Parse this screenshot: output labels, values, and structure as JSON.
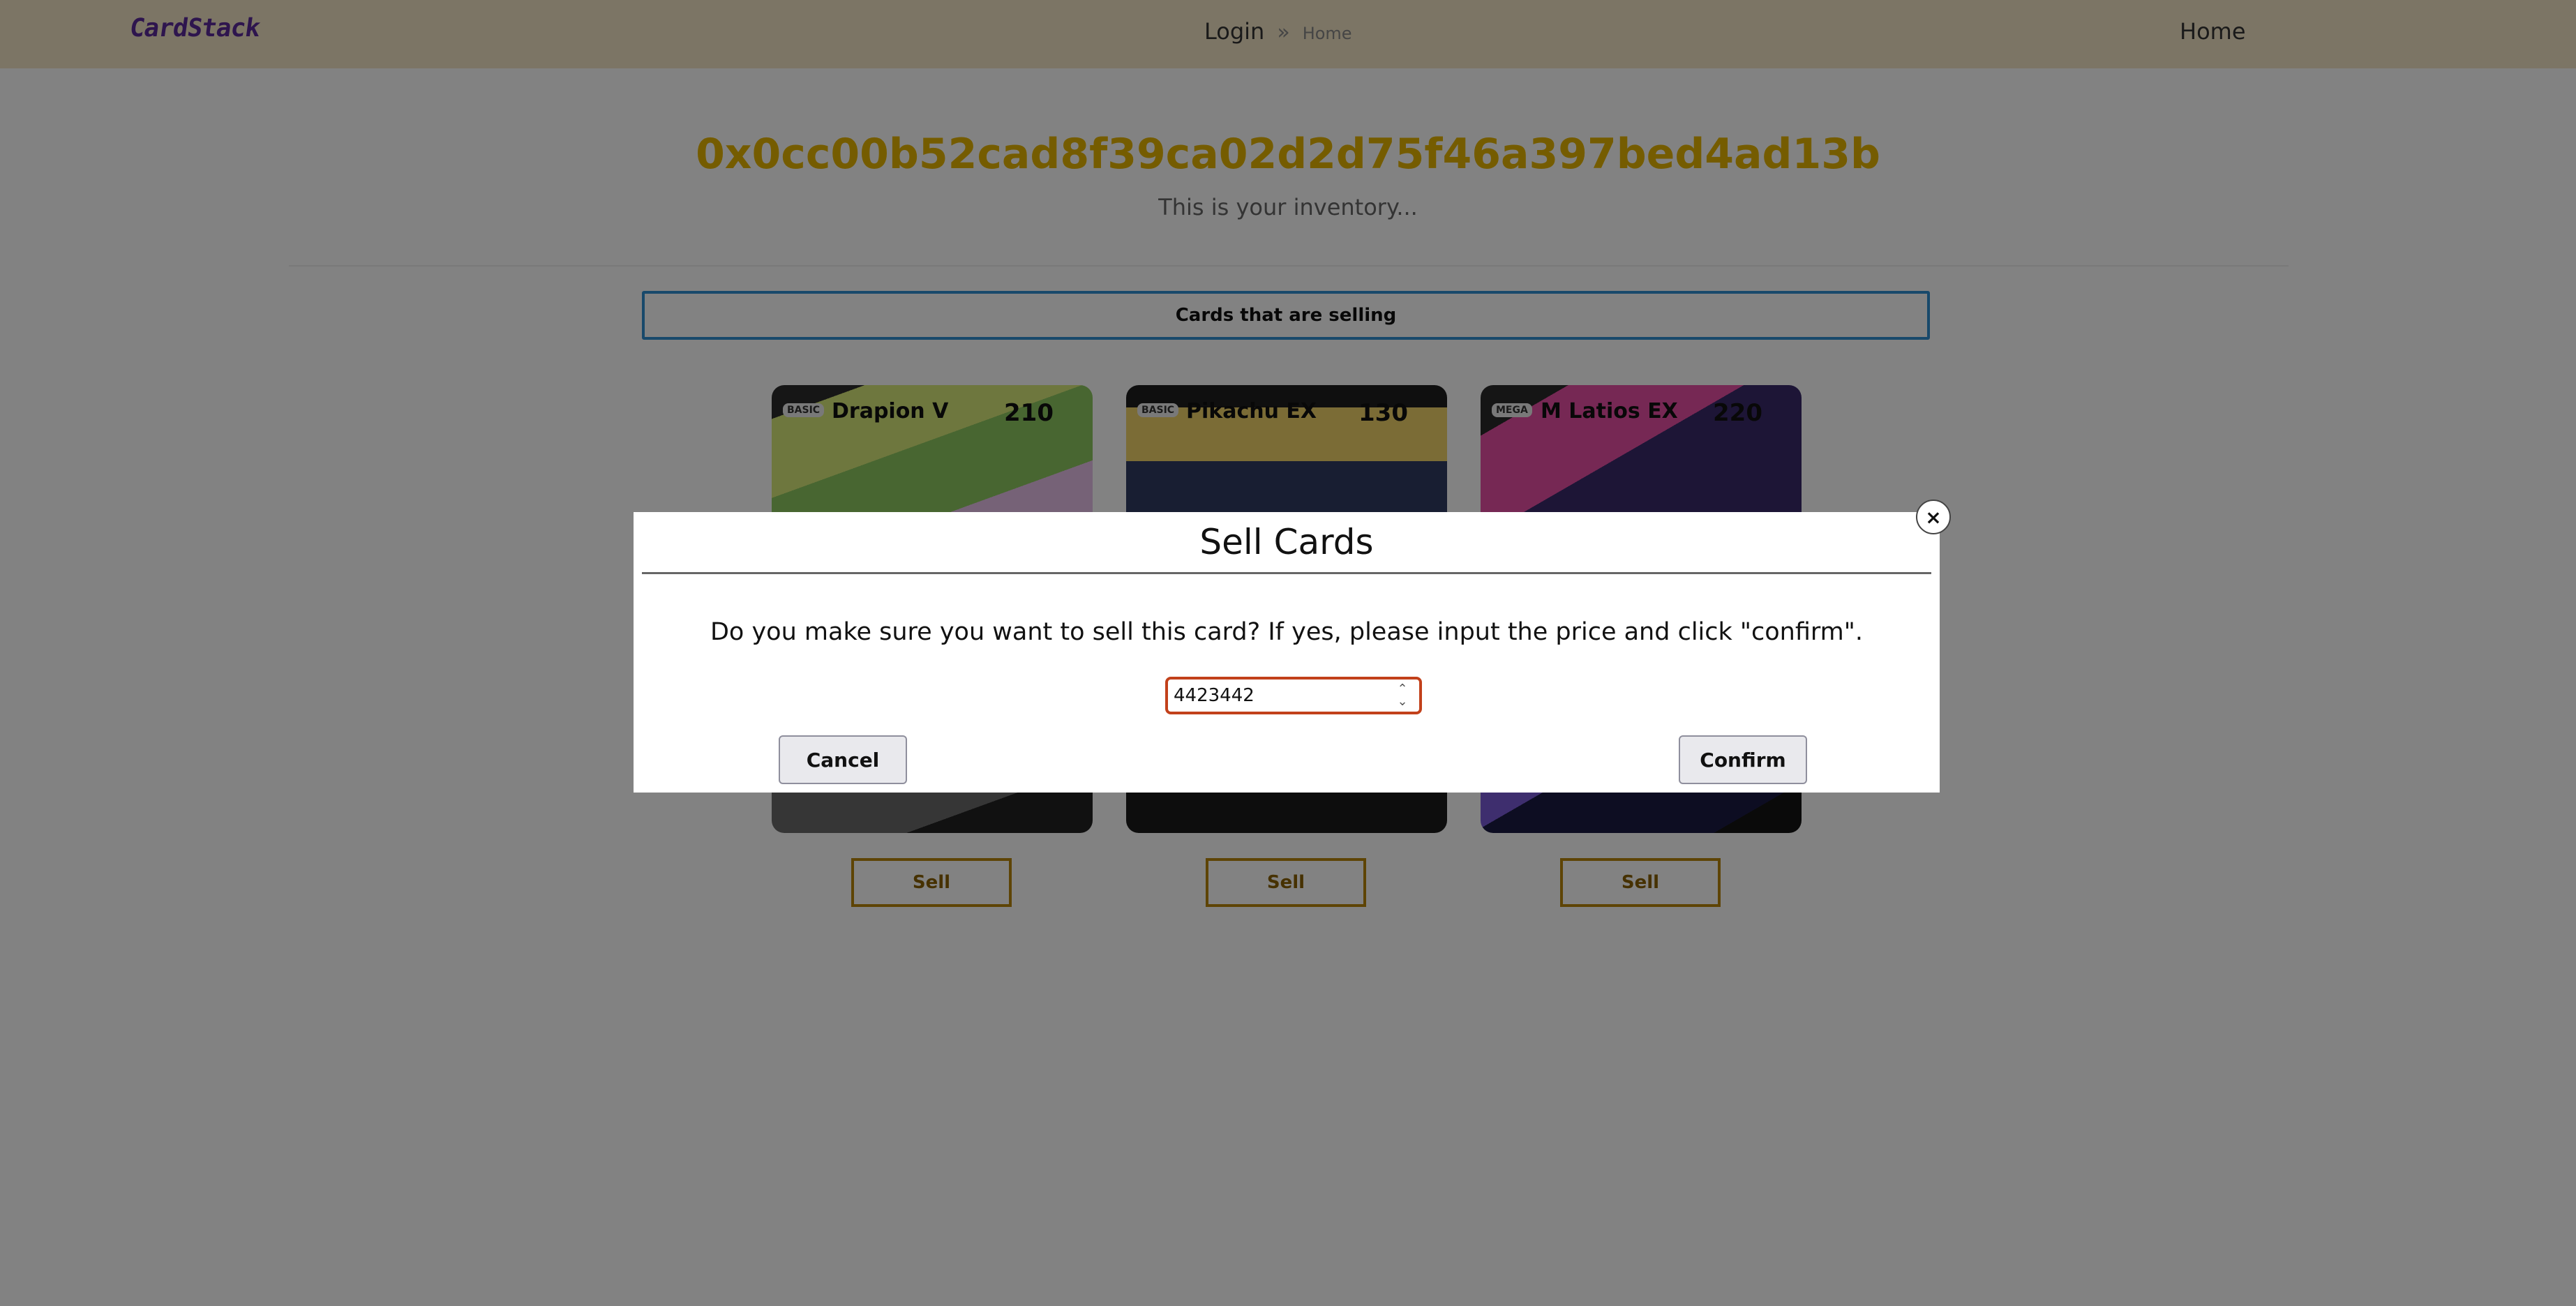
{
  "navbar": {
    "logo": "CardStack",
    "login": "Login",
    "separator": "»",
    "breadcrumb_home": "Home",
    "home": "Home"
  },
  "main": {
    "address": "0x0cc00b52cad8f39ca02d2d75f46a397bed4ad13b",
    "subtitle": "This is your inventory...",
    "section_tab": "Cards that are selling",
    "cards": [
      {
        "basic": "BASIC",
        "name": "Drapion V",
        "hp": "210",
        "sell_label": "Sell"
      },
      {
        "basic": "BASIC",
        "name": "Pikachu EX",
        "hp": "130",
        "sell_label": "Sell"
      },
      {
        "basic": "MEGA",
        "name": "M Latios EX",
        "hp": "220",
        "sell_label": "Sell"
      }
    ]
  },
  "modal": {
    "title": "Sell Cards",
    "question": "Do you make sure you want to sell this card? If yes, please input the price and click \"confirm\".",
    "price_value": "4423442",
    "cancel_label": "Cancel",
    "confirm_label": "Confirm",
    "close_symbol": "×"
  },
  "colors": {
    "navbar_bg": "#f3e5c6",
    "address": "#e6b400",
    "tab_border": "#2f8fd3",
    "sell_border": "#b8860b",
    "input_border": "#c2411b"
  },
  "icons": {
    "close": "close-icon",
    "spinner_up": "chevron-up-icon",
    "spinner_down": "chevron-down-icon"
  }
}
